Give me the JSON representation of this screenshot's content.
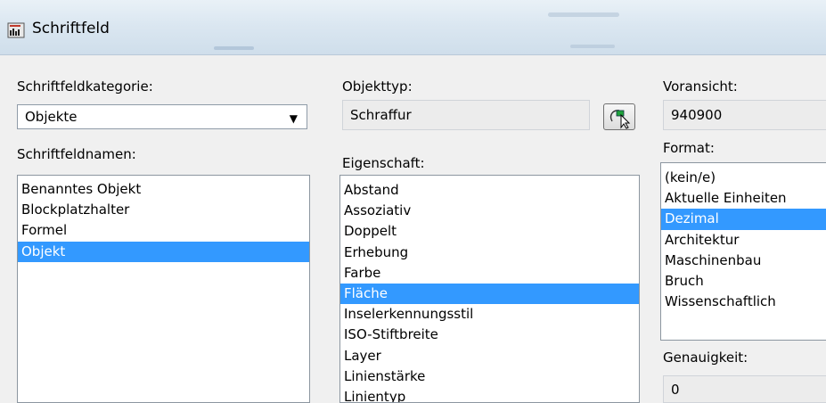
{
  "window": {
    "title": "Schriftfeld"
  },
  "category": {
    "label": "Schriftfeldkategorie:",
    "value": "Objekte"
  },
  "field_names": {
    "label": "Schriftfeldnamen:",
    "items": [
      "Benanntes Objekt",
      "Blockplatzhalter",
      "Formel",
      "Objekt"
    ],
    "selected": "Objekt"
  },
  "object_type": {
    "label": "Objekttyp:",
    "value": "Schraffur"
  },
  "property": {
    "label": "Eigenschaft:",
    "items": [
      "Abstand",
      "Assoziativ",
      "Doppelt",
      "Erhebung",
      "Farbe",
      "Fläche",
      "Inselerkennungsstil",
      "ISO-Stiftbreite",
      "Layer",
      "Linienstärke",
      "Linientyp"
    ],
    "selected": "Fläche"
  },
  "preview": {
    "label": "Voransicht:",
    "value": "940900"
  },
  "format": {
    "label": "Format:",
    "items": [
      "(kein/e)",
      "Aktuelle Einheiten",
      "Dezimal",
      "Architektur",
      "Maschinenbau",
      "Bruch",
      "Wissenschaftlich"
    ],
    "selected": "Dezimal"
  },
  "precision": {
    "label": "Genauigkeit:",
    "value": "0"
  },
  "colors": {
    "selection": "#3399ff",
    "dialog_bg": "#f0f0f0"
  },
  "icons": [
    "app-icon",
    "select-object-icon",
    "chevron-down-icon"
  ]
}
